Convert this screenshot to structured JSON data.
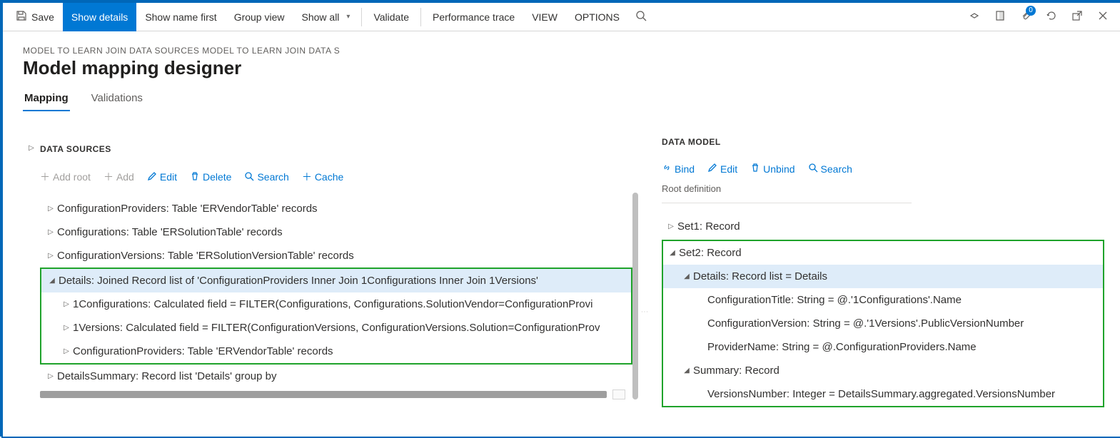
{
  "cmdbar": {
    "save": "Save",
    "show_details": "Show details",
    "show_name_first": "Show name first",
    "group_view": "Group view",
    "show_all": "Show all",
    "validate": "Validate",
    "perf_trace": "Performance trace",
    "view": "VIEW",
    "options": "OPTIONS",
    "badge": "0"
  },
  "header": {
    "breadcrumb": "MODEL TO LEARN JOIN DATA SOURCES MODEL TO LEARN JOIN DATA S",
    "title": "Model mapping designer"
  },
  "tabs": {
    "mapping": "Mapping",
    "validations": "Validations"
  },
  "left": {
    "panel": "DATA SOURCES",
    "toolbar": {
      "add_root": "Add root",
      "add": "Add",
      "edit": "Edit",
      "delete": "Delete",
      "search": "Search",
      "cache": "Cache"
    },
    "nodes": {
      "n0": "ConfigurationProviders: Table 'ERVendorTable' records",
      "n1": "Configurations: Table 'ERSolutionTable' records",
      "n2": "ConfigurationVersions: Table 'ERSolutionVersionTable' records",
      "n3": "Details: Joined Record list of 'ConfigurationProviders Inner Join 1Configurations Inner Join 1Versions'",
      "n3a": "1Configurations: Calculated field = FILTER(Configurations, Configurations.SolutionVendor=ConfigurationProvi",
      "n3b": "1Versions: Calculated field = FILTER(ConfigurationVersions, ConfigurationVersions.Solution=ConfigurationProv",
      "n3c": "ConfigurationProviders: Table 'ERVendorTable' records",
      "n4": "DetailsSummary: Record list 'Details' group by"
    }
  },
  "right": {
    "panel": "DATA MODEL",
    "toolbar": {
      "bind": "Bind",
      "edit": "Edit",
      "unbind": "Unbind",
      "search": "Search"
    },
    "subhead": "Root definition",
    "nodes": {
      "r0": "Set1: Record",
      "r1": "Set2: Record",
      "r1a": "Details: Record list = Details",
      "r1a1": "ConfigurationTitle: String = @.'1Configurations'.Name",
      "r1a2": "ConfigurationVersion: String = @.'1Versions'.PublicVersionNumber",
      "r1a3": "ProviderName: String = @.ConfigurationProviders.Name",
      "r1b": "Summary: Record",
      "r1b1": "VersionsNumber: Integer = DetailsSummary.aggregated.VersionsNumber"
    }
  }
}
